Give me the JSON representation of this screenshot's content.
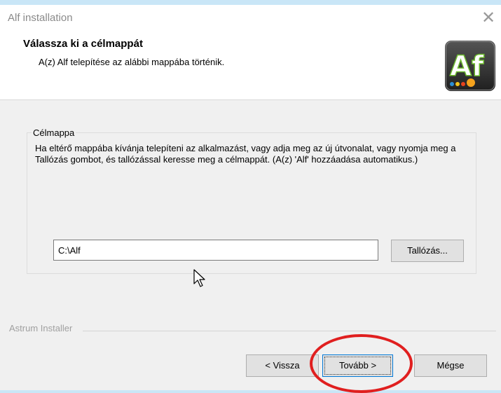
{
  "window": {
    "title": "Alf installation",
    "close_glyph": "✕"
  },
  "header": {
    "title": "Válassza ki a célmappát",
    "subtitle": "A(z) Alf telepítése az alábbi mappába történik.",
    "logo": {
      "text": "Af",
      "icon": "alf-app-logo"
    }
  },
  "group": {
    "label": "Célmappa",
    "description": "Ha eltérő mappába kívánja telepíteni az alkalmazást, vagy adja meg az új útvonalat, vagy nyomja meg a Tallózás gombot, és tallózással keresse meg a célmappát. (A(z) 'Alf' hozzáadása automatikus.)"
  },
  "path": {
    "value": "C:\\Alf"
  },
  "buttons": {
    "browse": "Tallózás...",
    "back": "< Vissza",
    "next": "Tovább >",
    "cancel": "Mégse"
  },
  "footer": {
    "installer_name": "Astrum Installer"
  },
  "colors": {
    "highlight": "#e01f1f",
    "logo_background": "#3a3a3a",
    "logo_green": "#6dbb2e",
    "focus_border": "#0078d7"
  }
}
